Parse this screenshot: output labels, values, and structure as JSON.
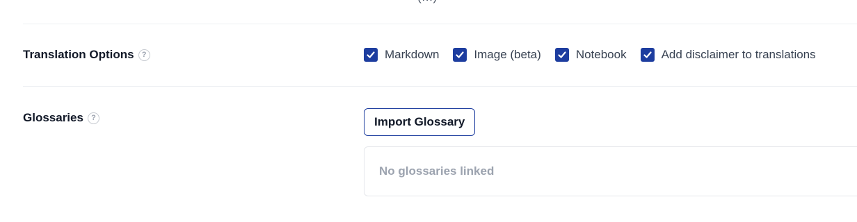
{
  "top_partial_text": "(…)",
  "translation_options": {
    "label": "Translation Options",
    "help_glyph": "?",
    "checkbox_color": "#1d3d9f",
    "options": [
      {
        "label": "Markdown",
        "checked": true
      },
      {
        "label": "Image (beta)",
        "checked": true
      },
      {
        "label": "Notebook",
        "checked": true
      },
      {
        "label": "Add disclaimer to translations",
        "checked": true
      }
    ]
  },
  "glossaries": {
    "label": "Glossaries",
    "help_glyph": "?",
    "import_button_label": "Import Glossary",
    "empty_text": "No glossaries linked"
  }
}
